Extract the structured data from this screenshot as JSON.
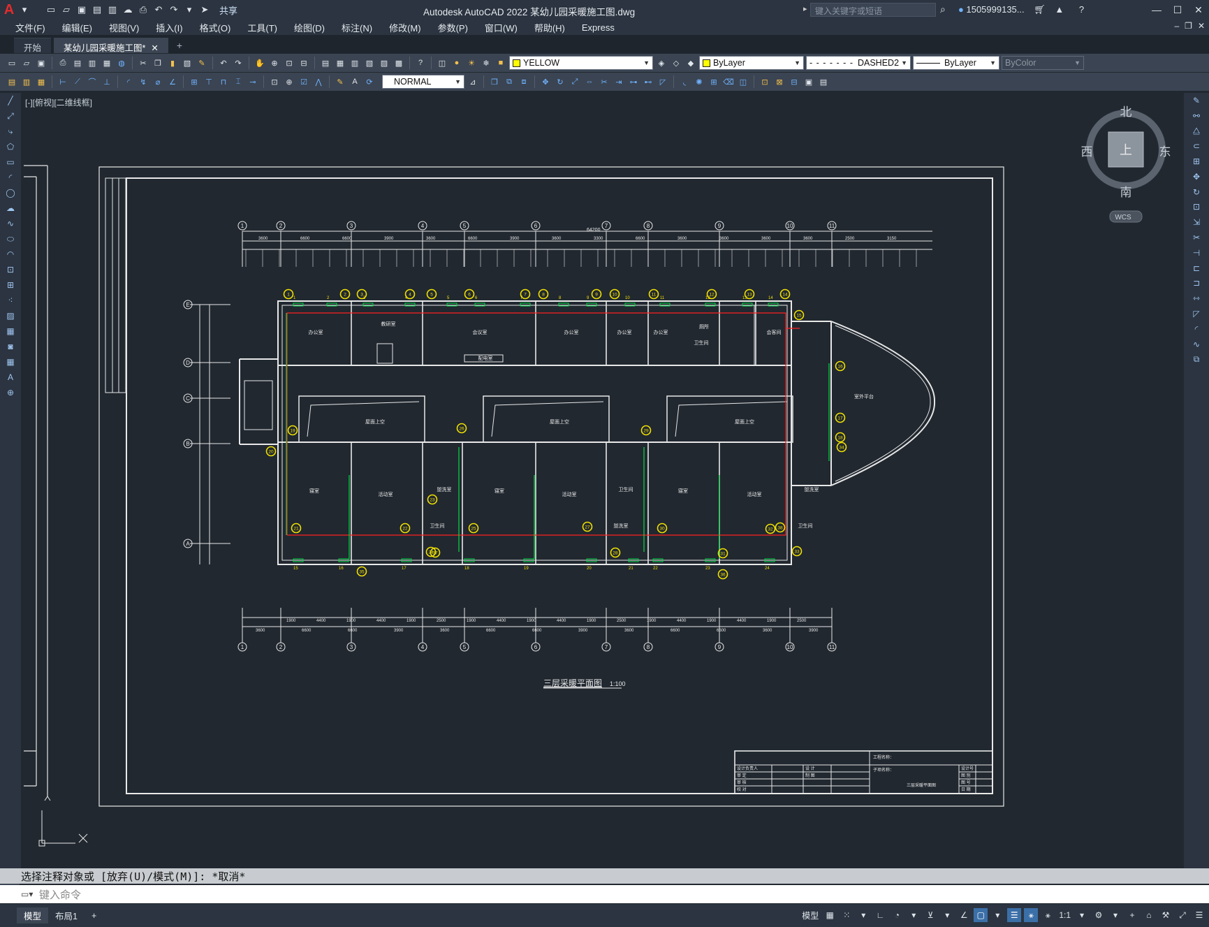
{
  "app": {
    "logo": "A",
    "title": "Autodesk AutoCAD 2022    某幼儿园采暖施工图.dwg",
    "share_label": "共享",
    "search_placeholder": "键入关键字或短语",
    "user": "1505999135..."
  },
  "qat_icons": [
    "new-icon",
    "open-icon",
    "save-icon",
    "save-as-icon",
    "plot-icon",
    "cloud-icon",
    "print-icon",
    "undo-icon",
    "redo-icon",
    "share-icon"
  ],
  "menu": [
    "文件(F)",
    "编辑(E)",
    "视图(V)",
    "插入(I)",
    "格式(O)",
    "工具(T)",
    "绘图(D)",
    "标注(N)",
    "修改(M)",
    "参数(P)",
    "窗口(W)",
    "帮助(H)",
    "Express"
  ],
  "tabs": [
    {
      "label": "开始",
      "active": false
    },
    {
      "label": "某幼儿园采暖施工图*",
      "active": true
    }
  ],
  "toolbar1": {
    "layer": "YELLOW",
    "color": "ByLayer",
    "linetype": "DASHED2",
    "lineweight": "ByLayer",
    "plotstyle": "ByColor"
  },
  "toolbar2": {
    "style": "NORMAL"
  },
  "viewport_label": "[-][俯视][二维线框]",
  "viewcube": {
    "north": "北",
    "south": "南",
    "east": "东",
    "west": "西",
    "top": "上",
    "wcs": "WCS"
  },
  "drawing": {
    "title": "三层采暖平面图",
    "scale": "1:100",
    "total_dim": "64200",
    "top_dims": [
      "3600",
      "6600",
      "6600",
      "3900",
      "3600",
      "6600",
      "3900",
      "3600",
      "3300",
      "6600",
      "3600",
      "3600",
      "3600",
      "3600",
      "2500",
      "3150"
    ],
    "bottom_dims": [
      "3600",
      "6600",
      "6600",
      "3900",
      "3600",
      "6600",
      "6600",
      "3900",
      "3600",
      "6600",
      "6600",
      "3600",
      "3900"
    ],
    "bottom_sub_dims": [
      "1900",
      "4400",
      "1900",
      "4400",
      "1900",
      "2500",
      "1900",
      "4400",
      "1900",
      "4400",
      "1900",
      "2500",
      "1900",
      "4400",
      "1900",
      "4400",
      "1900",
      "2500"
    ],
    "axes_h": [
      "1",
      "2",
      "3",
      "4",
      "5",
      "6",
      "7",
      "8",
      "9",
      "10",
      "11"
    ],
    "axes_v": [
      "E",
      "D",
      "C",
      "B",
      "A"
    ],
    "rooms": [
      "办公室",
      "教研室",
      "会议室",
      "办公室",
      "办公室",
      "办公室",
      "卫生间",
      "会客间",
      "寝室",
      "活动室",
      "寝室",
      "活动室",
      "寝室",
      "活动室",
      "盥洗室",
      "卫生间",
      "盥洗室",
      "卫生间",
      "盥洗室",
      "卫生间",
      "室外平台",
      "屋面上空",
      "屋面上空",
      "屋面上空",
      "配电室",
      "厕所"
    ],
    "radiator_ids": [
      "1",
      "2",
      "3",
      "4",
      "5",
      "6",
      "7",
      "8",
      "9",
      "10",
      "11",
      "12",
      "13",
      "14",
      "15",
      "16",
      "17",
      "18",
      "19",
      "20",
      "21",
      "22",
      "23",
      "24",
      "25",
      "26",
      "27",
      "28",
      "29",
      "30",
      "31",
      "32",
      "33",
      "34",
      "35",
      "36",
      "37",
      "38"
    ],
    "title_block": {
      "project": "工程名称：",
      "sub": "子项名称：",
      "sheet_title": "三层采暖平面图",
      "rows": [
        "设计负责人",
        "审 定",
        "审 核",
        "校 对",
        "设 计",
        "制 图"
      ],
      "meta": [
        "设计号",
        "图 别",
        "图 号",
        "日 期"
      ]
    }
  },
  "command": {
    "history": "选择注释对象或 [放弃(U)/模式(M)]: *取消*",
    "placeholder": "键入命令"
  },
  "status": {
    "layout_tabs": [
      "模型",
      "布局1"
    ],
    "model_label": "模型",
    "scale": "1:1"
  },
  "colors": {
    "background": "#212830",
    "panel": "#2b3440",
    "toolbar": "#3b4452",
    "layer_yellow": "#ffff00",
    "pipe_red": "#ff2020",
    "pipe_green": "#00dd44",
    "bubble_yellow": "#f0e000",
    "lines_white": "#e8e8e8"
  }
}
